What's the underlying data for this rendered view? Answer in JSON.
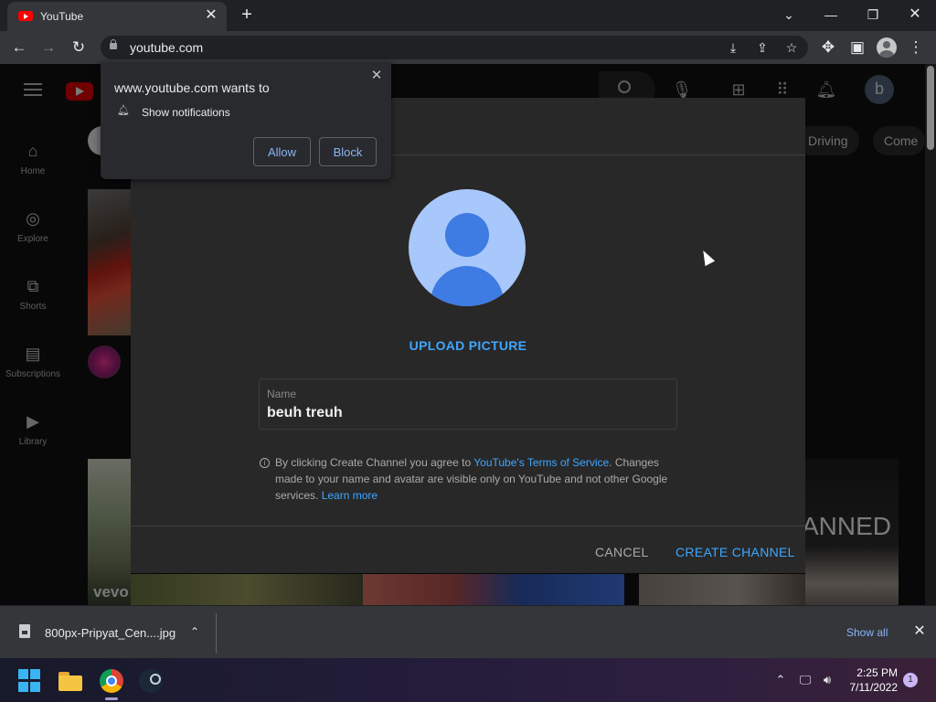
{
  "browser": {
    "tab_title": "YouTube",
    "url": "youtube.com"
  },
  "permission_prompt": {
    "title": "www.youtube.com wants to",
    "permission": "Show notifications",
    "allow_label": "Allow",
    "block_label": "Block"
  },
  "youtube": {
    "avatar_letter": "b",
    "guide": [
      {
        "label": "Home"
      },
      {
        "label": "Explore"
      },
      {
        "label": "Shorts"
      },
      {
        "label": "Subscriptions"
      },
      {
        "label": "Library"
      }
    ],
    "chips": [
      "Driving",
      "Come"
    ],
    "thumbnail_texts": [
      "vevo",
      "ANNED"
    ]
  },
  "dialog": {
    "upload_label": "UPLOAD PICTURE",
    "name_label": "Name",
    "name_value": "beuh treuh",
    "terms_prefix": "By clicking Create Channel you agree to ",
    "terms_link": "YouTube's Terms of Service",
    "terms_middle": ". Changes made to your name and avatar are visible only on YouTube and not other Google services. ",
    "learn_more": "Learn more",
    "cancel_label": "CANCEL",
    "create_label": "CREATE CHANNEL"
  },
  "download_bar": {
    "file_name": "800px-Pripyat_Cen....jpg",
    "show_all": "Show all"
  },
  "taskbar": {
    "time": "2:25 PM",
    "date": "7/11/2022",
    "notification_count": "1"
  },
  "colors": {
    "accent_blue": "#3ea6ff",
    "chrome_link": "#8ab4f8",
    "youtube_red": "#ff0000"
  }
}
